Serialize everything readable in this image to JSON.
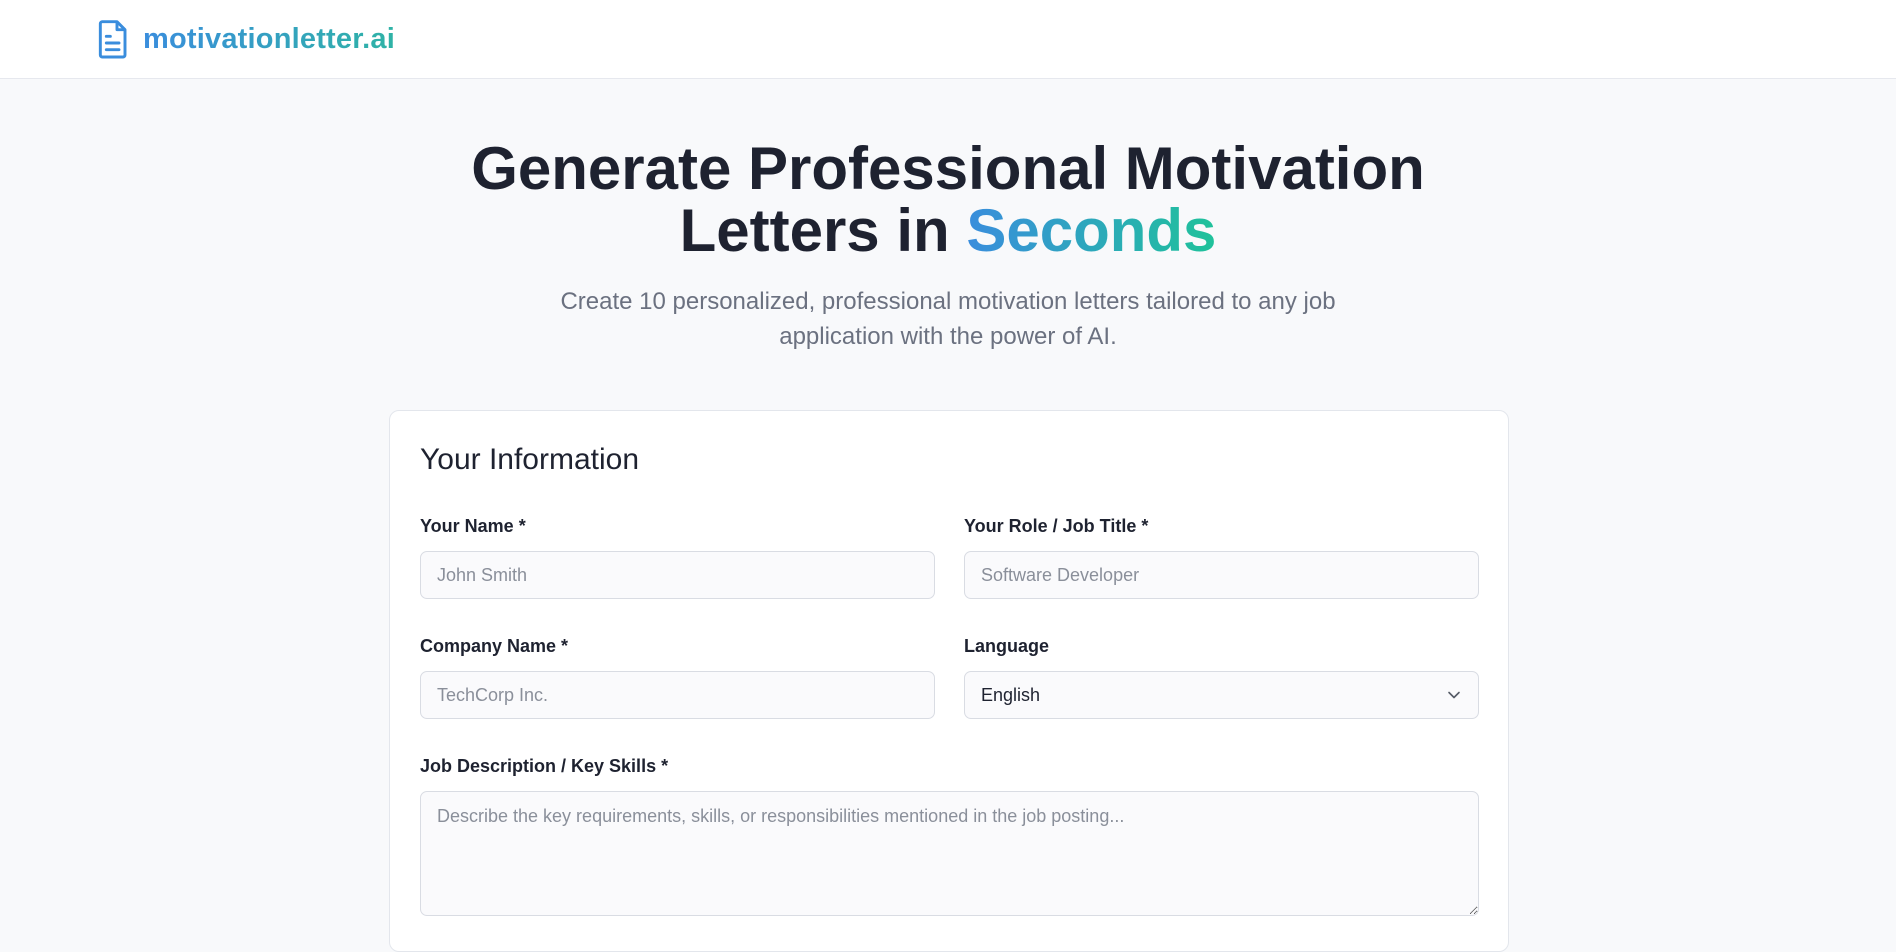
{
  "brand": {
    "name": "motivationletter.ai",
    "icon": "document-icon",
    "color_start": "#3a8ddd",
    "color_end": "#2fb3a6"
  },
  "hero": {
    "title_line1": "Generate Professional Motivation",
    "title_line2_prefix": "Letters in ",
    "title_accent": "Seconds",
    "subtitle": "Create 10 personalized, professional motivation letters tailored to any job application with the power of AI."
  },
  "form": {
    "title": "Your Information",
    "name": {
      "label": "Your Name *",
      "placeholder": "John Smith"
    },
    "role": {
      "label": "Your Role / Job Title *",
      "placeholder": "Software Developer"
    },
    "company": {
      "label": "Company Name *",
      "placeholder": "TechCorp Inc."
    },
    "language": {
      "label": "Language",
      "value": "English",
      "icon": "chevron-down-icon"
    },
    "description": {
      "label": "Job Description / Key Skills *",
      "placeholder": "Describe the key requirements, skills, or responsibilities mentioned in the job posting..."
    }
  }
}
